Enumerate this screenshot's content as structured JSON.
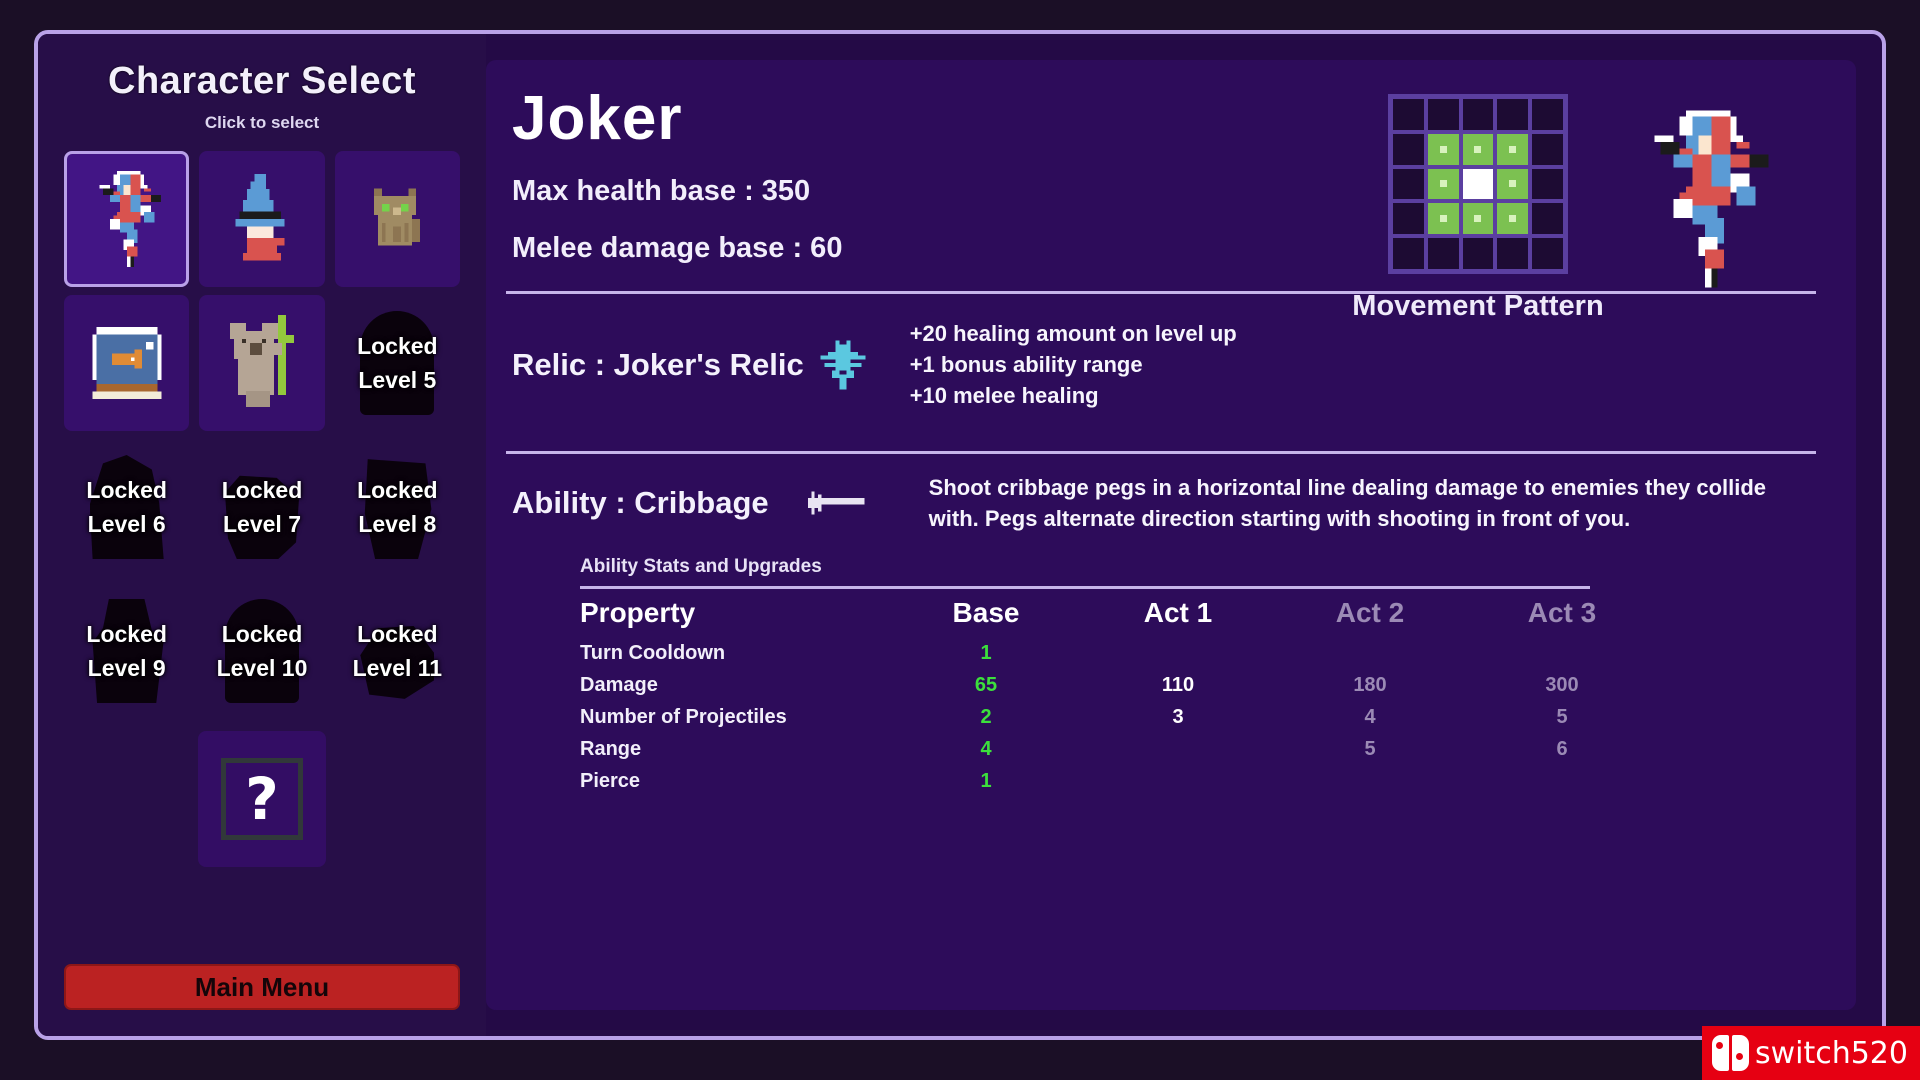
{
  "sidebar": {
    "title": "Character Select",
    "subtitle": "Click to select",
    "mystery_glyph": "?",
    "main_menu_label": "Main Menu",
    "slots": [
      {
        "id": "joker",
        "state": "selected",
        "sprite": "joker-sprite",
        "label": ""
      },
      {
        "id": "wizard",
        "state": "unlocked",
        "sprite": "wizard-sprite",
        "label": ""
      },
      {
        "id": "cat",
        "state": "unlocked",
        "sprite": "cat-sprite",
        "label": ""
      },
      {
        "id": "fishbowl",
        "state": "unlocked",
        "sprite": "fishbowl-sprite",
        "label": ""
      },
      {
        "id": "koala",
        "state": "unlocked",
        "sprite": "koala-sprite",
        "label": ""
      },
      {
        "id": "locked5",
        "state": "locked",
        "locked_line1": "Locked",
        "locked_line2": "Level 5"
      },
      {
        "id": "locked6",
        "state": "locked",
        "locked_line1": "Locked",
        "locked_line2": "Level 6"
      },
      {
        "id": "locked7",
        "state": "locked",
        "locked_line1": "Locked",
        "locked_line2": "Level 7"
      },
      {
        "id": "locked8",
        "state": "locked",
        "locked_line1": "Locked",
        "locked_line2": "Level 8"
      },
      {
        "id": "locked9",
        "state": "locked",
        "locked_line1": "Locked",
        "locked_line2": "Level 9"
      },
      {
        "id": "locked10",
        "state": "locked",
        "locked_line1": "Locked",
        "locked_line2": "Level 10"
      },
      {
        "id": "locked11",
        "state": "locked",
        "locked_line1": "Locked",
        "locked_line2": "Level 11"
      }
    ]
  },
  "detail": {
    "character_name": "Joker",
    "max_health_label": "Max health base : 350",
    "melee_damage_label": "Melee damage base : 60",
    "movement": {
      "label": "Movement Pattern",
      "rows": 5,
      "cols": 5,
      "cells": [
        [
          "empty",
          "empty",
          "empty",
          "empty",
          "empty"
        ],
        [
          "empty",
          "move",
          "move",
          "move",
          "empty"
        ],
        [
          "empty",
          "move",
          "center",
          "move",
          "empty"
        ],
        [
          "empty",
          "move",
          "move",
          "move",
          "empty"
        ],
        [
          "empty",
          "empty",
          "empty",
          "empty",
          "empty"
        ]
      ]
    },
    "relic": {
      "label": "Relic : Joker's Relic",
      "icon": "relic-frog-icon",
      "effects": [
        "+20 healing amount on level up",
        "+1 bonus ability range",
        "+10 melee healing"
      ]
    },
    "ability": {
      "label": "Ability : Cribbage",
      "icon": "cribbage-peg-icon",
      "description": "Shoot cribbage pegs in a horizontal line dealing damage to enemies they collide with. Pegs alternate direction starting with shooting in front of you."
    },
    "stats": {
      "caption": "Ability Stats and Upgrades",
      "columns": [
        "Property",
        "Base",
        "Act 1",
        "Act 2",
        "Act 3"
      ],
      "rows": [
        {
          "property": "Turn Cooldown",
          "base": "1",
          "act1": "",
          "act2": "",
          "act3": ""
        },
        {
          "property": "Damage",
          "base": "65",
          "act1": "110",
          "act2": "180",
          "act3": "300"
        },
        {
          "property": "Number of Projectiles",
          "base": "2",
          "act1": "3",
          "act2": "4",
          "act3": "5"
        },
        {
          "property": "Range",
          "base": "4",
          "act1": "",
          "act2": "5",
          "act3": "6"
        },
        {
          "property": "Pierce",
          "base": "1",
          "act1": "",
          "act2": "",
          "act3": ""
        }
      ]
    }
  },
  "watermark": {
    "text": "switch520",
    "logo": "nintendo-switch-icon"
  },
  "colors": {
    "frame_border": "#b9a1e8",
    "sidebar_bg": "#270e48",
    "panel_bg": "#2d0c5a",
    "slot_bg": "#360f6b",
    "slot_selected_bg": "#421585",
    "base_value": "#3ce03c",
    "dim_text": "#9b8ab5",
    "move_cell": "#7cc151",
    "main_menu_bg": "#bb2222",
    "watermark_bg": "#e60012"
  }
}
